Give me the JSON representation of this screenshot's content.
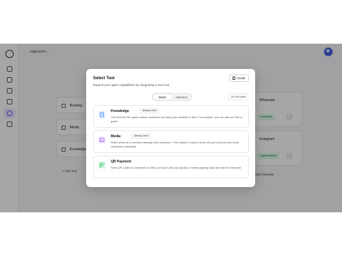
{
  "header": {
    "workspace": "rogersoen",
    "chevron_icon": "chevron-down-icon"
  },
  "sidebar": {
    "icons": [
      "grid-icon",
      "rocket-icon",
      "image-icon",
      "flag-icon",
      "bot-icon",
      "book-icon"
    ]
  },
  "background": {
    "tool_cards": [
      {
        "label": "Booking",
        "icon": "calendar-icon"
      },
      {
        "label": "Media",
        "icon": "image-icon"
      },
      {
        "label": "Knowledge",
        "icon": "link-icon"
      }
    ],
    "add_tool": "Add Tool",
    "channels": [
      {
        "title": "Whatsapp",
        "status": "connected",
        "link_icon": "external-link-icon"
      },
      {
        "title": "Instagram",
        "status": "rogersonstudio",
        "link_icon": "external-link-icon"
      }
    ],
    "add_channels": "Add Channels"
  },
  "modal": {
    "title": "Select Tool",
    "subtitle": "Expand your agent capabilities by integrating a new tool.",
    "guide_label": "Guide",
    "tabs": [
      "Basic",
      "Advance"
    ],
    "tools_used": "2/6 Tool Used",
    "tools": [
      {
        "name": "Knowledge",
        "badge": "Already Used",
        "description": "This tool lets the agent answer questions by using your website or files. For example, you can add an FAQ or guide.",
        "icon": "document-icon",
        "icon_color": "#3b82f6",
        "icon_bg": "#eff6ff"
      },
      {
        "name": "Media",
        "badge": "Already Used",
        "description": "Share pictures or product catalogs with customers. This makes it easy to show off your products and keep customers interested.",
        "icon": "image-icon",
        "icon_color": "#a855f7",
        "icon_bg": "#faf5ff"
      },
      {
        "name": "QR Payment",
        "badge": "",
        "description": "Send QR codes to customers so they can scan and pay quickly. It makes paying easy and fast for everyone.",
        "icon": "qr-icon",
        "icon_color": "#22c55e",
        "icon_bg": "#f0fdf4"
      }
    ]
  }
}
